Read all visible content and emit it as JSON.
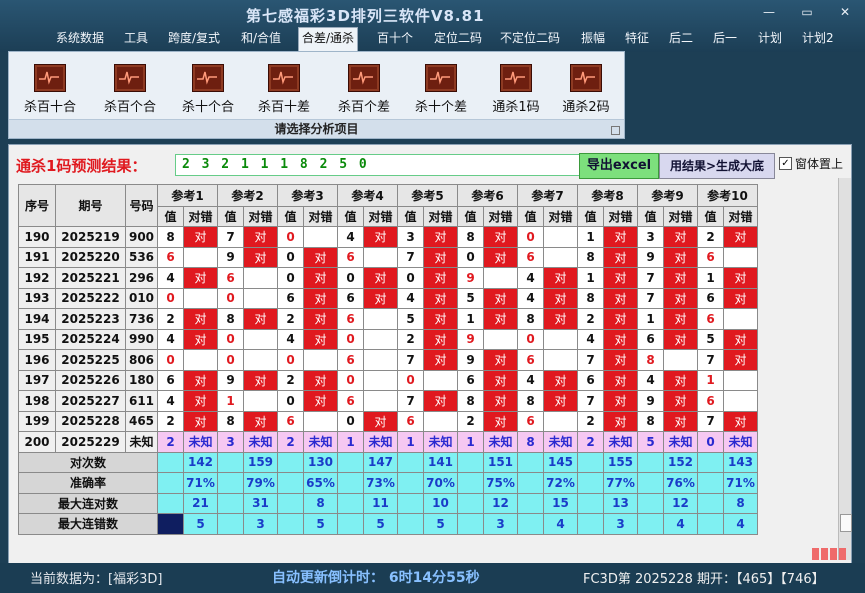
{
  "title": "第七感福彩3D排列三软件V8.81",
  "window": {
    "min": "—",
    "max": "▭",
    "close": "✕"
  },
  "menu": [
    "系统数据",
    "工具",
    "跨度/复式",
    "和/合值",
    "合差/通杀",
    "百十个",
    "定位二码",
    "不定位二码",
    "振幅",
    "特征",
    "后二",
    "后一",
    "计划",
    "计划2"
  ],
  "menu_active": 4,
  "ribbon": {
    "buttons": [
      "杀百十合",
      "杀百个合",
      "杀十个合",
      "杀百十差",
      "杀百个差",
      "杀十个差",
      "通杀1码",
      "通杀2码"
    ],
    "caption": "请选择分析项目"
  },
  "prediction": {
    "label": "通杀1码预测结果：",
    "value": "2 3 2 1 1 1 8 2 5 0",
    "export_button": "导出excel",
    "generate_button": "用结果>生成大底",
    "pin_label": "窗体置上",
    "pin_checked": true
  },
  "table": {
    "headers": {
      "seq": "序号",
      "issue": "期号",
      "num": "号码",
      "val": "值",
      "hit": "对错"
    },
    "refs": [
      "参考1",
      "参考2",
      "参考3",
      "参考4",
      "参考5",
      "参考6",
      "参考7",
      "参考8",
      "参考9",
      "参考10"
    ],
    "hit_text": "对",
    "unknown_text": "未知",
    "rows": [
      {
        "seq": "190",
        "issue": "2025219",
        "num": "900",
        "vals": [
          "8",
          "7",
          "0",
          "4",
          "3",
          "8",
          "0",
          "1",
          "3",
          "2"
        ],
        "hits": [
          1,
          1,
          0,
          1,
          1,
          1,
          0,
          1,
          1,
          1
        ]
      },
      {
        "seq": "191",
        "issue": "2025220",
        "num": "536",
        "vals": [
          "6",
          "9",
          "0",
          "6",
          "7",
          "0",
          "6",
          "8",
          "9",
          "6"
        ],
        "hits": [
          0,
          1,
          1,
          0,
          1,
          1,
          0,
          1,
          1,
          0
        ]
      },
      {
        "seq": "192",
        "issue": "2025221",
        "num": "296",
        "vals": [
          "4",
          "6",
          "0",
          "0",
          "0",
          "9",
          "4",
          "1",
          "7",
          "1"
        ],
        "hits": [
          1,
          0,
          1,
          1,
          1,
          0,
          1,
          1,
          1,
          1
        ]
      },
      {
        "seq": "193",
        "issue": "2025222",
        "num": "010",
        "vals": [
          "0",
          "0",
          "6",
          "6",
          "4",
          "5",
          "4",
          "8",
          "7",
          "6"
        ],
        "hits": [
          0,
          0,
          1,
          1,
          1,
          1,
          1,
          1,
          1,
          1
        ]
      },
      {
        "seq": "194",
        "issue": "2025223",
        "num": "736",
        "vals": [
          "2",
          "8",
          "2",
          "6",
          "5",
          "1",
          "8",
          "2",
          "1",
          "6"
        ],
        "hits": [
          1,
          1,
          1,
          0,
          1,
          1,
          1,
          1,
          1,
          0
        ]
      },
      {
        "seq": "195",
        "issue": "2025224",
        "num": "990",
        "vals": [
          "4",
          "0",
          "4",
          "0",
          "2",
          "9",
          "0",
          "4",
          "6",
          "5"
        ],
        "hits": [
          1,
          0,
          1,
          0,
          1,
          0,
          0,
          1,
          1,
          1
        ]
      },
      {
        "seq": "196",
        "issue": "2025225",
        "num": "806",
        "vals": [
          "0",
          "0",
          "0",
          "6",
          "7",
          "9",
          "6",
          "7",
          "8",
          "7"
        ],
        "hits": [
          0,
          0,
          0,
          0,
          1,
          1,
          0,
          1,
          0,
          1
        ]
      },
      {
        "seq": "197",
        "issue": "2025226",
        "num": "180",
        "vals": [
          "6",
          "9",
          "2",
          "0",
          "0",
          "6",
          "4",
          "6",
          "4",
          "1"
        ],
        "hits": [
          1,
          1,
          1,
          0,
          0,
          1,
          1,
          1,
          1,
          0
        ]
      },
      {
        "seq": "198",
        "issue": "2025227",
        "num": "611",
        "vals": [
          "4",
          "1",
          "0",
          "6",
          "7",
          "8",
          "8",
          "7",
          "9",
          "6"
        ],
        "hits": [
          1,
          0,
          1,
          0,
          1,
          1,
          1,
          1,
          1,
          0
        ]
      },
      {
        "seq": "199",
        "issue": "2025228",
        "num": "465",
        "vals": [
          "2",
          "8",
          "6",
          "0",
          "6",
          "2",
          "6",
          "2",
          "8",
          "7"
        ],
        "hits": [
          1,
          1,
          0,
          1,
          0,
          1,
          0,
          1,
          1,
          1
        ]
      }
    ],
    "pred_row": {
      "seq": "200",
      "issue": "2025229",
      "num": "未知",
      "vals": [
        "2",
        "3",
        "2",
        "1",
        "1",
        "1",
        "8",
        "2",
        "5",
        "0"
      ]
    },
    "stats": [
      {
        "label": "对次数",
        "values": [
          "142",
          "159",
          "130",
          "147",
          "141",
          "151",
          "145",
          "155",
          "152",
          "143"
        ]
      },
      {
        "label": "准确率",
        "values": [
          "71%",
          "79%",
          "65%",
          "73%",
          "70%",
          "75%",
          "72%",
          "77%",
          "76%",
          "71%"
        ]
      },
      {
        "label": "最大连对数",
        "values": [
          "21",
          "31",
          "8",
          "11",
          "10",
          "12",
          "15",
          "13",
          "12",
          "8"
        ]
      },
      {
        "label": "最大连错数",
        "values": [
          "5",
          "3",
          "5",
          "5",
          "5",
          "3",
          "4",
          "3",
          "4",
          "4"
        ]
      }
    ]
  },
  "status": {
    "current_data": "当前数据为：[福彩3D]",
    "countdown": "自动更新倒计时： 6时14分55秒",
    "draw_info": "FC3D第 2025228 期开：【465】【746】"
  },
  "colors": {
    "hit": "#e0191f",
    "pred_row": "#f6c8f2",
    "stats": "#7ff0f2",
    "navy": "#0f1e60"
  }
}
